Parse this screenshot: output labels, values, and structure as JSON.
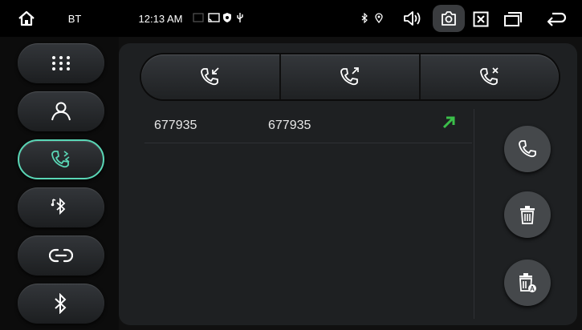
{
  "status_bar": {
    "app_label": "BT",
    "time": "12:13 AM",
    "icons": [
      "home-icon",
      "cast-icon",
      "shield-icon",
      "usb-icon",
      "bluetooth-small-icon",
      "location-icon",
      "volume-icon",
      "screenshot-icon",
      "close-box-icon",
      "window-icon",
      "back-icon"
    ]
  },
  "sidebar": {
    "items": [
      {
        "name": "dialpad",
        "icon": "dialpad-icon"
      },
      {
        "name": "contacts",
        "icon": "person-icon"
      },
      {
        "name": "call-log",
        "icon": "call-log-icon",
        "active": true
      },
      {
        "name": "bt-music",
        "icon": "music-bluetooth-icon"
      },
      {
        "name": "connect",
        "icon": "link-icon"
      },
      {
        "name": "bt-settings",
        "icon": "bluetooth-icon"
      }
    ]
  },
  "call_log": {
    "tabs": [
      {
        "name": "incoming",
        "icon": "incoming-call-icon"
      },
      {
        "name": "outgoing",
        "icon": "outgoing-call-icon"
      },
      {
        "name": "missed",
        "icon": "missed-call-icon"
      }
    ],
    "rows": [
      {
        "name": "677935",
        "number": "677935",
        "direction": "outgoing"
      }
    ]
  },
  "actions": [
    "call-icon",
    "delete-icon",
    "delete-all-icon"
  ],
  "colors": {
    "accent": "#5ad7b6",
    "outgoing_arrow": "#3bbf4a"
  }
}
